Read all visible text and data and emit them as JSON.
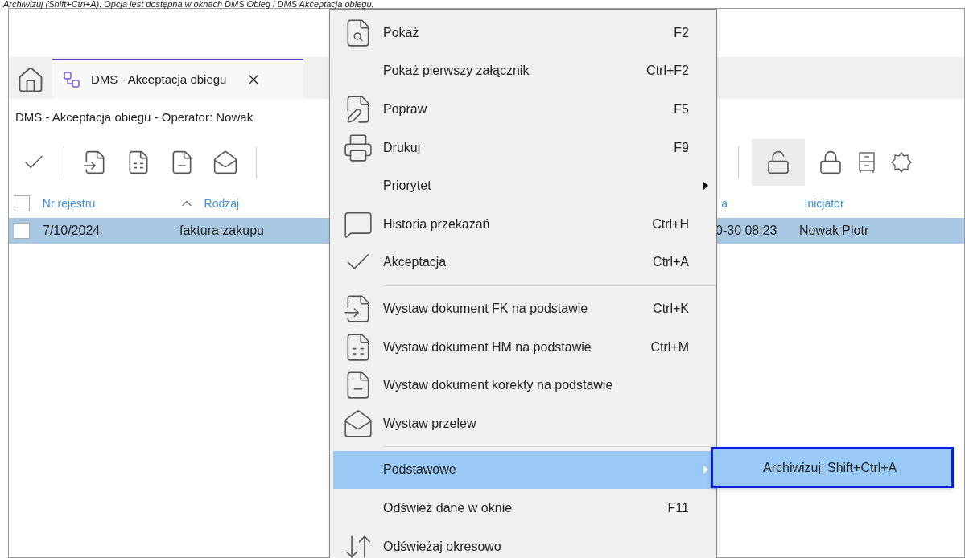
{
  "caption": "Archiwizuj (Shift+Ctrl+A). Opcja jest dostępna w oknach DMS Obieg i DMS Akceptacja obiegu.",
  "tabs": [
    {
      "label": "DMS - Akceptacja obiegu",
      "selected": true
    }
  ],
  "window_title": "DMS - Akceptacja obiegu - Operator: Nowak",
  "select_all": {
    "checked": false
  },
  "columns": [
    {
      "label": "Nr rejestru"
    },
    {
      "label": "Rodzaj",
      "sorted": true
    },
    {
      "label": "a"
    },
    {
      "label": "Inicjator"
    }
  ],
  "rows": [
    {
      "selected": true,
      "checked": false,
      "cells": [
        "7/10/2024",
        "faktura zakupu",
        "0-30 08:23",
        "Nowak Piotr"
      ]
    }
  ],
  "menu": [
    {
      "kind": "item",
      "label": "Pokaż",
      "shortcut": "F2",
      "selected": false
    },
    {
      "kind": "item",
      "label": "Pokaż pierwszy załącznik",
      "shortcut": "Ctrl+F2",
      "selected": false
    },
    {
      "kind": "item",
      "label": "Popraw",
      "shortcut": "F5",
      "selected": false
    },
    {
      "kind": "item",
      "label": "Drukuj",
      "shortcut": "F9",
      "selected": false
    },
    {
      "kind": "submenu",
      "label": "Priorytet",
      "selected": false
    },
    {
      "kind": "item",
      "label": "Historia przekazań",
      "shortcut": "Ctrl+H",
      "selected": false
    },
    {
      "kind": "item",
      "label": "Akceptacja",
      "shortcut": "Ctrl+A",
      "selected": false
    },
    {
      "kind": "separator"
    },
    {
      "kind": "item",
      "label": "Wystaw dokument FK na podstawie",
      "shortcut": "Ctrl+K",
      "selected": false
    },
    {
      "kind": "item",
      "label": "Wystaw dokument HM na podstawie",
      "shortcut": "Ctrl+M",
      "selected": false
    },
    {
      "kind": "item",
      "label": "Wystaw dokument korekty na podstawie",
      "selected": false
    },
    {
      "kind": "item",
      "label": "Wystaw przelew",
      "selected": false
    },
    {
      "kind": "separator"
    },
    {
      "kind": "submenu",
      "label": "Podstawowe",
      "selected": true
    },
    {
      "kind": "item",
      "label": "Odśwież dane w oknie",
      "shortcut": "F11",
      "selected": false
    },
    {
      "kind": "item",
      "label": "Odświeżaj okresowo",
      "selected": false
    }
  ],
  "submenu": {
    "label": "Archiwizuj",
    "shortcut": "Shift+Ctrl+A",
    "selected": true
  }
}
